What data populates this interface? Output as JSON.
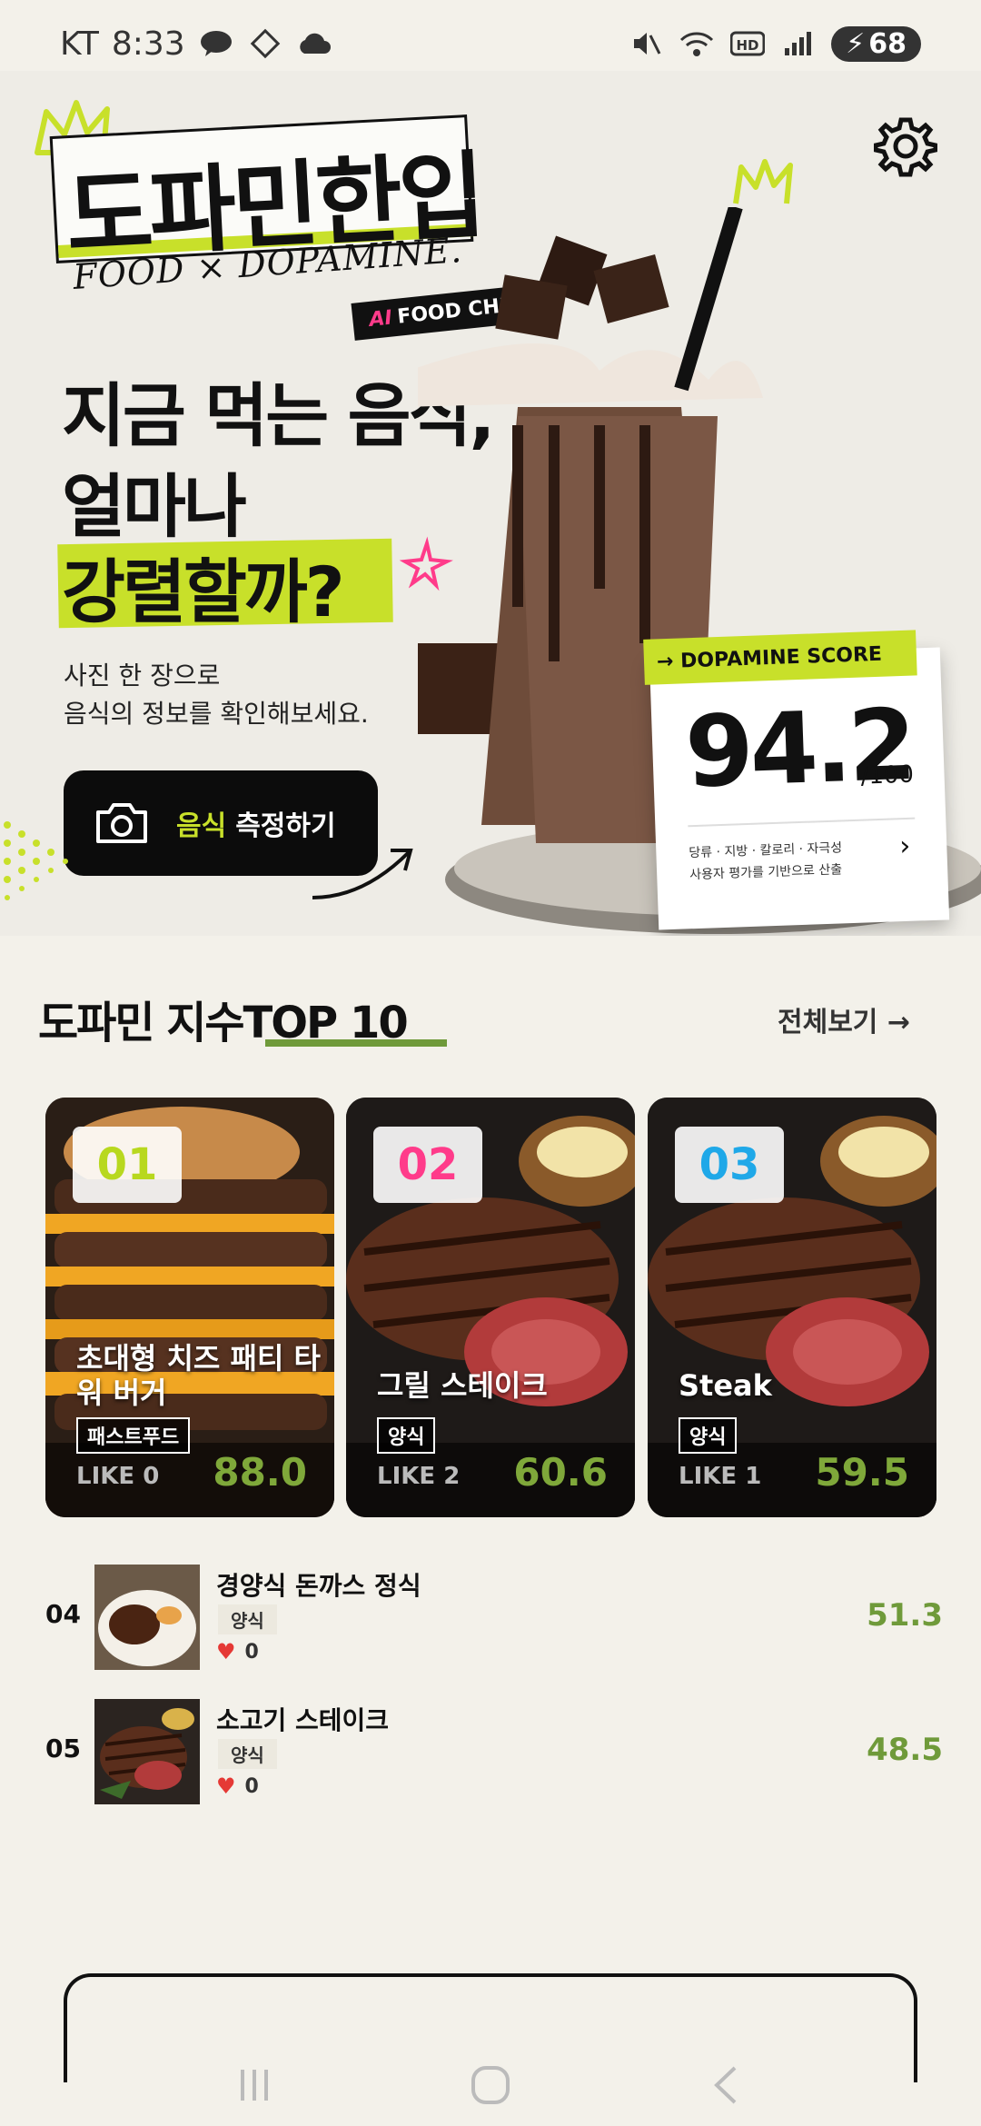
{
  "status_bar": {
    "carrier": "KT",
    "time": "8:33",
    "battery": "68"
  },
  "hero": {
    "logo": "도파민한입",
    "logo_sub": "FOOD × DOPAMINE.",
    "ai_badge_ai": "AI",
    "ai_badge_text": "FOOD CHECK",
    "headline_1": "지금 먹는 음식,",
    "headline_2": "얼마나",
    "headline_3": "강렬할까?",
    "desc_1": "사진 한 장으로",
    "desc_2": "음식의 정보를 확인해보세요.",
    "cta_highlight": "음식",
    "cta_label": "측정하기",
    "score_label": "→ DOPAMINE SCORE",
    "score_value": "94.2",
    "score_max": "/100",
    "score_note_1": "당류 · 지방 · 칼로리 · 자극성",
    "score_note_2": "사용자 평가를 기반으로 산출"
  },
  "ranking": {
    "title": "도파민 지수TOP 10",
    "see_all": "전체보기 →",
    "top": [
      {
        "rank": "01",
        "title": "초대형 치즈 패티 타워 버거",
        "category": "패스트푸드",
        "like": "LIKE 0",
        "score": "88.0",
        "rank_color": "#b8d81e"
      },
      {
        "rank": "02",
        "title": "그릴 스테이크",
        "category": "양식",
        "like": "LIKE 2",
        "score": "60.6",
        "rank_color": "#ff3b8a"
      },
      {
        "rank": "03",
        "title": "Steak",
        "category": "양식",
        "like": "LIKE 1",
        "score": "59.5",
        "rank_color": "#1fa8e8"
      }
    ],
    "list": [
      {
        "rank": "04",
        "name": "경양식 돈까스 정식",
        "category": "양식",
        "likes": "0",
        "score": "51.3"
      },
      {
        "rank": "05",
        "name": "소고기 스테이크",
        "category": "양식",
        "likes": "0",
        "score": "48.5"
      }
    ]
  },
  "colors": {
    "accent": "#c8e02a",
    "score_green": "#6f9a3a",
    "background": "#f3f1ea"
  }
}
